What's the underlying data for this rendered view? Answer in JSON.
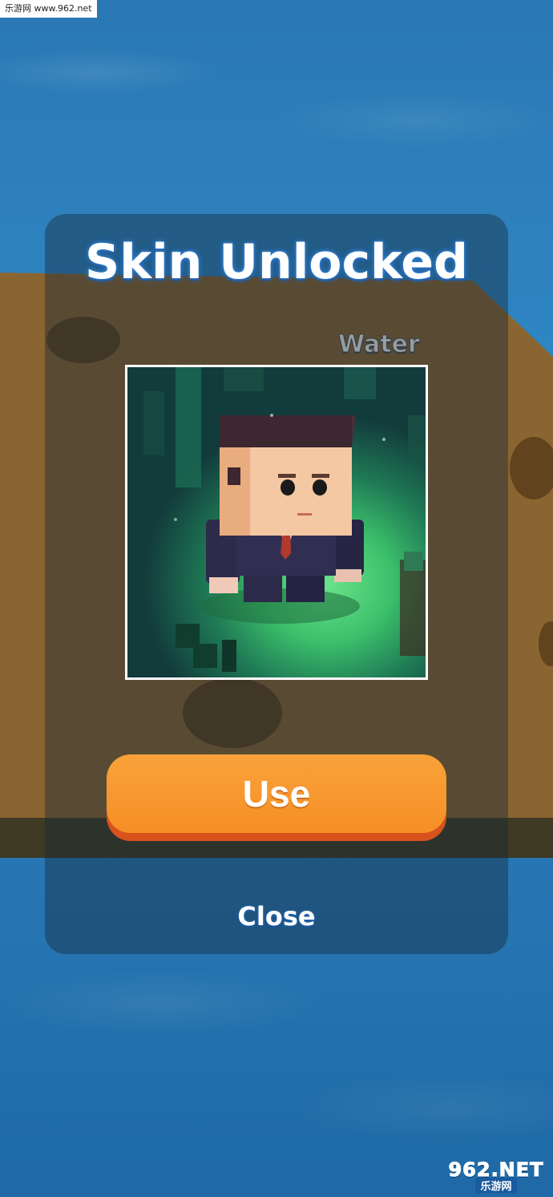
{
  "watermark": {
    "top_text": "乐游网 www.962.net",
    "logo_main": "962",
    "logo_suffix": ".NET",
    "logo_sub": "乐游网"
  },
  "background": {
    "sign_label": "Water"
  },
  "popup": {
    "title": "Skin Unlocked",
    "preview_icon": "character-skin-preview",
    "use_label": "Use",
    "close_label": "Close"
  },
  "colors": {
    "use_button": "#f58f25",
    "use_button_shadow": "#d7521c",
    "title_glow": "#2a73c9",
    "preview_border": "#ffffff"
  }
}
